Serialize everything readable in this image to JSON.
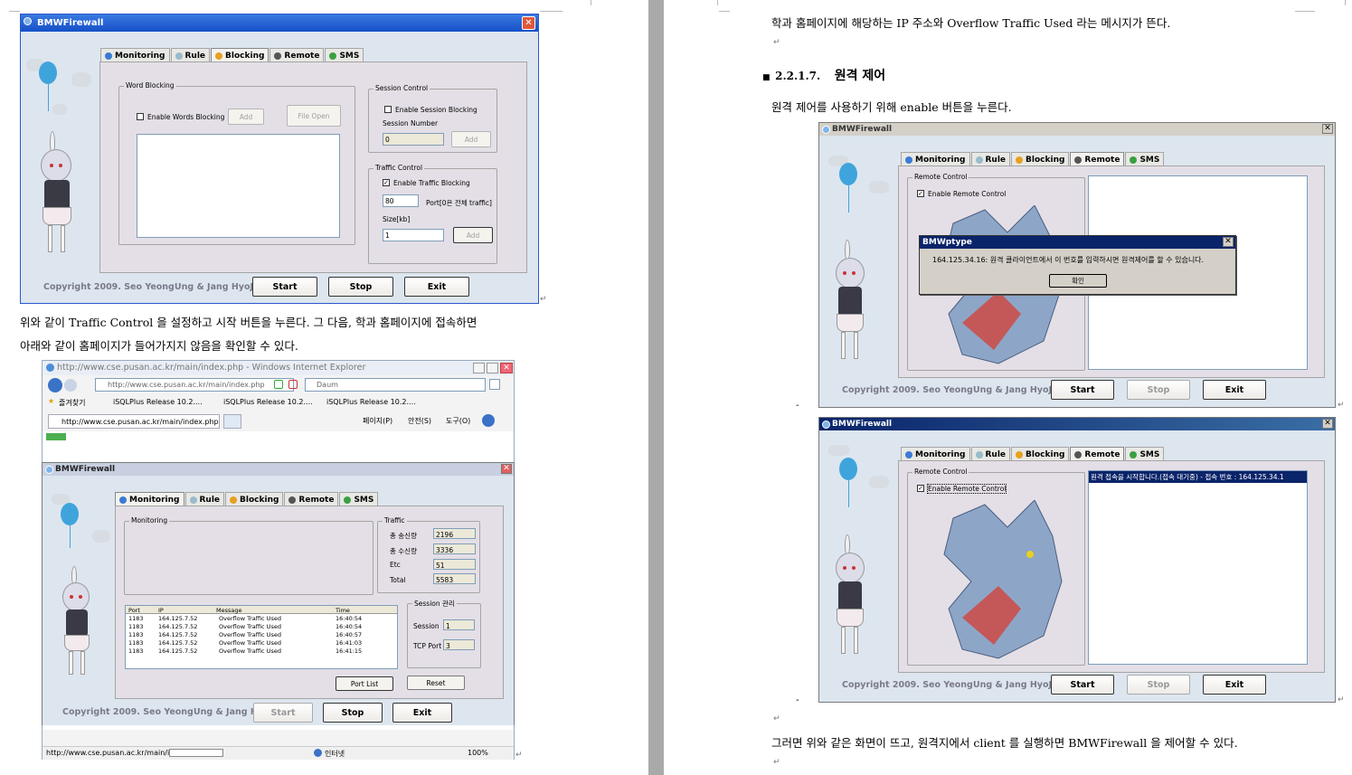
{
  "document": {
    "caption_1_line1": "위와 같이 Traffic Control 을 설정하고 시작 버튼을 누른다. 그 다음, 학과 홈페이지에 접속하면",
    "caption_1_line2": "아래와 같이 홈페이지가 들어가지지 않음을 확인할 수 있다.",
    "top_line": "학과 홈페이지에 해당하는 IP 주소와 Overflow Traffic Used 라는 메시지가 뜬다.",
    "section_number": "2.2.1.7.",
    "section_title": "원격 제어",
    "remote_intro": "원격 제어를 사용하기 위해  enable 버튼을 누른다.",
    "closing_text": "그러면 위와 같은 화면이 뜨고, 원격지에서 client 를 실행하면 BMWFirewall 을 제어할 수 있다.",
    "para_mark": "↵",
    "dash": "-"
  },
  "app": {
    "title": "BMWFirewall",
    "tabs": [
      "Monitoring",
      "Rule",
      "Blocking",
      "Remote",
      "SMS"
    ],
    "copyright": "Copyright 2009. Seo YeongUng & Jang HyoJin",
    "btn_start": "Start",
    "btn_stop": "Stop",
    "btn_exit": "Exit",
    "close_glyph": "✕"
  },
  "blocking": {
    "word_group": "Word Blocking",
    "enable_words": "Enable Words Blocking",
    "add": "Add",
    "file_open": "File Open",
    "session_group": "Session Control",
    "enable_session": "Enable Session Blocking",
    "session_number": "Session Number",
    "session_number_value": "0",
    "traffic_group": "Traffic Control",
    "enable_traffic": "Enable Traffic Blocking",
    "traffic_checked": "✓",
    "port_value": "80",
    "port_label": "Port[0은 전체 traffic]",
    "size_label": "Size[kb]",
    "size_value": "1"
  },
  "ie": {
    "title": "http://www.cse.pusan.ac.kr/main/index.php - Windows Internet Explorer",
    "url": "http://www.cse.pusan.ac.kr/main/index.php",
    "search": "Daum",
    "favorites": "즐겨찾기",
    "fav1": "iSQLPlus Release 10.2....",
    "fav2": "iSQLPlus Release 10.2....",
    "fav3": "iSQLPlus Release 10.2....",
    "tab": "http://www.cse.pusan.ac.kr/main/index.php",
    "toolbar_page": "페이지(P)",
    "toolbar_safety": "안전(S)",
    "toolbar_tools": "도구(O)",
    "status_url": "http://www.cse.pusan.ac.kr/main/i",
    "zone": "인터넷",
    "zoom": "100%"
  },
  "monitoring": {
    "monitor_group": "Monitoring",
    "traffic_group": "Traffic",
    "sent_label": "총 송신량",
    "sent_value": "2196",
    "recv_label": "총 수신량",
    "recv_value": "3336",
    "etc_label": "Etc",
    "etc_value": "51",
    "total_label": "Total",
    "total_value": "5583",
    "columns": [
      "Port",
      "IP",
      "Message",
      "Time"
    ],
    "rows": [
      [
        "1183",
        "164.125.7.52",
        "Overflow Traffic Used",
        "16:40:54"
      ],
      [
        "1183",
        "164.125.7.52",
        "Overflow Traffic Used",
        "16:40:54"
      ],
      [
        "1183",
        "164.125.7.52",
        "Overflow Traffic Used",
        "16:40:57"
      ],
      [
        "1183",
        "164.125.7.52",
        "Overflow Traffic Used",
        "16:41:03"
      ],
      [
        "1183",
        "164.125.7.52",
        "Overflow Traffic Used",
        "16:41:15"
      ]
    ],
    "session_group": "Session 관리",
    "session_label": "Session",
    "session_value": "1",
    "tcp_label": "TCP Port",
    "tcp_value": "3",
    "port_list": "Port List",
    "reset": "Reset"
  },
  "remote": {
    "group": "Remote Control",
    "enable": "Enable Remote Control",
    "checked": "✓",
    "dialog_title": "BMWptype",
    "dialog_message": "164.125.34.16: 원격 클라이언트에서 이 번호를 입력하시면 원격제어를 할 수 있습니다.",
    "dialog_ok": "확인",
    "status_line": "원격 접속을 시작합니다.(접속 대기중) - 접속 번호 : 164.125.34.1"
  }
}
